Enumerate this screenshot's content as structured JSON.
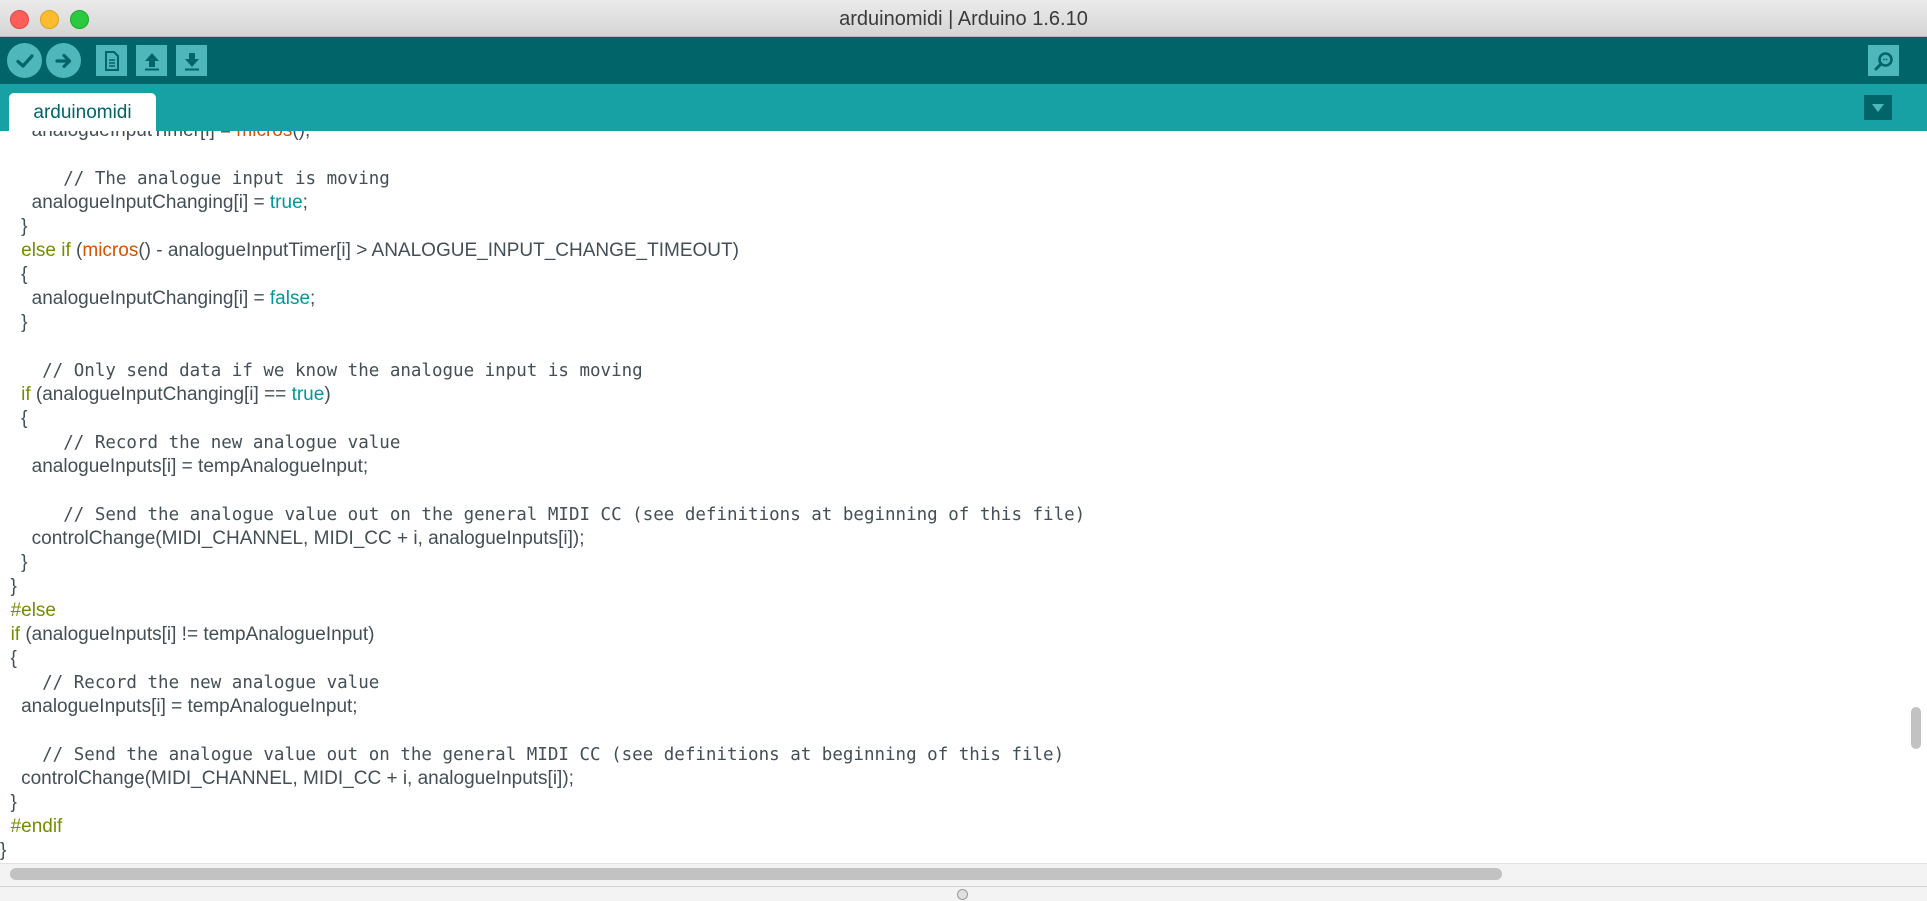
{
  "window": {
    "title": "arduinomidi | Arduino 1.6.10",
    "controls": [
      "close-icon",
      "minimize-icon",
      "zoom-icon"
    ]
  },
  "toolbar": {
    "buttons": [
      {
        "name": "verify",
        "icon": "check-icon"
      },
      {
        "name": "upload",
        "icon": "arrow-right-icon"
      },
      {
        "name": "new",
        "icon": "document-icon"
      },
      {
        "name": "open",
        "icon": "arrow-up-icon"
      },
      {
        "name": "save",
        "icon": "arrow-down-icon"
      }
    ],
    "serial_monitor_icon": "magnifier-icon"
  },
  "tabs": [
    {
      "label": "arduinomidi",
      "active": true
    }
  ],
  "tab_menu_icon": "triangle-down-icon",
  "colors": {
    "toolbar_bg": "#006468",
    "tabbar_bg": "#17a1a5",
    "button_bg": "#4db7bb",
    "keyword": "#728e00",
    "function": "#d35400",
    "literal": "#00979c",
    "text": "#434f54"
  },
  "editor": {
    "lines": [
      [
        {
          "t": "      analogueInputTimer[i] = ",
          "c": "plain"
        },
        {
          "t": "micros",
          "c": "function"
        },
        {
          "t": "();",
          "c": "plain"
        }
      ],
      [],
      [
        {
          "t": "      // The analogue input is moving",
          "c": "comment"
        }
      ],
      [
        {
          "t": "      analogueInputChanging[i] = ",
          "c": "plain"
        },
        {
          "t": "true",
          "c": "literal"
        },
        {
          "t": ";",
          "c": "plain"
        }
      ],
      [
        {
          "t": "    }",
          "c": "plain"
        }
      ],
      [
        {
          "t": "    ",
          "c": "plain"
        },
        {
          "t": "else",
          "c": "keyword"
        },
        {
          "t": " ",
          "c": "plain"
        },
        {
          "t": "if",
          "c": "keyword"
        },
        {
          "t": " (",
          "c": "plain"
        },
        {
          "t": "micros",
          "c": "function"
        },
        {
          "t": "() - analogueInputTimer[i] > ANALOGUE_INPUT_CHANGE_TIMEOUT)",
          "c": "plain"
        }
      ],
      [
        {
          "t": "    {",
          "c": "plain"
        }
      ],
      [
        {
          "t": "      analogueInputChanging[i] = ",
          "c": "plain"
        },
        {
          "t": "false",
          "c": "literal"
        },
        {
          "t": ";",
          "c": "plain"
        }
      ],
      [
        {
          "t": "    }",
          "c": "plain"
        }
      ],
      [],
      [
        {
          "t": "    // Only send data if we know the analogue input is moving",
          "c": "comment"
        }
      ],
      [
        {
          "t": "    ",
          "c": "plain"
        },
        {
          "t": "if",
          "c": "keyword"
        },
        {
          "t": " (analogueInputChanging[i] == ",
          "c": "plain"
        },
        {
          "t": "true",
          "c": "literal"
        },
        {
          "t": ")",
          "c": "plain"
        }
      ],
      [
        {
          "t": "    {",
          "c": "plain"
        }
      ],
      [
        {
          "t": "      // Record the new analogue value",
          "c": "comment"
        }
      ],
      [
        {
          "t": "      analogueInputs[i] = tempAnalogueInput;",
          "c": "plain"
        }
      ],
      [],
      [
        {
          "t": "      // Send the analogue value out on the general MIDI CC (see definitions at beginning of this file)",
          "c": "comment"
        }
      ],
      [
        {
          "t": "      controlChange(MIDI_CHANNEL, MIDI_CC + i, analogueInputs[i]);",
          "c": "plain"
        }
      ],
      [
        {
          "t": "    }",
          "c": "plain"
        }
      ],
      [
        {
          "t": "  }",
          "c": "plain"
        }
      ],
      [
        {
          "t": "  ",
          "c": "plain"
        },
        {
          "t": "#else",
          "c": "keyword"
        }
      ],
      [
        {
          "t": "  ",
          "c": "plain"
        },
        {
          "t": "if",
          "c": "keyword"
        },
        {
          "t": " (analogueInputs[i] != tempAnalogueInput)",
          "c": "plain"
        }
      ],
      [
        {
          "t": "  {",
          "c": "plain"
        }
      ],
      [
        {
          "t": "    // Record the new analogue value",
          "c": "comment"
        }
      ],
      [
        {
          "t": "    analogueInputs[i] = tempAnalogueInput;",
          "c": "plain"
        }
      ],
      [],
      [
        {
          "t": "    // Send the analogue value out on the general MIDI CC (see definitions at beginning of this file)",
          "c": "comment"
        }
      ],
      [
        {
          "t": "    controlChange(MIDI_CHANNEL, MIDI_CC + i, analogueInputs[i]);",
          "c": "plain"
        }
      ],
      [
        {
          "t": "  }",
          "c": "plain"
        }
      ],
      [
        {
          "t": "  ",
          "c": "plain"
        },
        {
          "t": "#endif",
          "c": "keyword"
        }
      ],
      [
        {
          "t": "}",
          "c": "plain"
        }
      ]
    ]
  }
}
